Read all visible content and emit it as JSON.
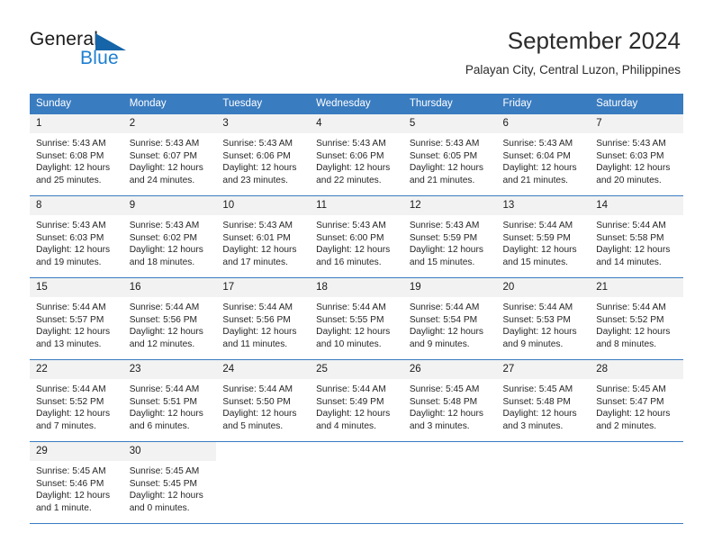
{
  "brand": {
    "name_part1": "General",
    "name_part2": "Blue",
    "logo_icon": "blue-triangle-icon",
    "accent_color": "#1f7fd1",
    "header_color": "#3a7cc0"
  },
  "header": {
    "title": "September 2024",
    "subtitle": "Palayan City, Central Luzon, Philippines"
  },
  "calendar": {
    "weekday_headers": [
      "Sunday",
      "Monday",
      "Tuesday",
      "Wednesday",
      "Thursday",
      "Friday",
      "Saturday"
    ],
    "weeks": [
      [
        {
          "day": "1",
          "sunrise": "Sunrise: 5:43 AM",
          "sunset": "Sunset: 6:08 PM",
          "daylight_line1": "Daylight: 12 hours",
          "daylight_line2": "and 25 minutes."
        },
        {
          "day": "2",
          "sunrise": "Sunrise: 5:43 AM",
          "sunset": "Sunset: 6:07 PM",
          "daylight_line1": "Daylight: 12 hours",
          "daylight_line2": "and 24 minutes."
        },
        {
          "day": "3",
          "sunrise": "Sunrise: 5:43 AM",
          "sunset": "Sunset: 6:06 PM",
          "daylight_line1": "Daylight: 12 hours",
          "daylight_line2": "and 23 minutes."
        },
        {
          "day": "4",
          "sunrise": "Sunrise: 5:43 AM",
          "sunset": "Sunset: 6:06 PM",
          "daylight_line1": "Daylight: 12 hours",
          "daylight_line2": "and 22 minutes."
        },
        {
          "day": "5",
          "sunrise": "Sunrise: 5:43 AM",
          "sunset": "Sunset: 6:05 PM",
          "daylight_line1": "Daylight: 12 hours",
          "daylight_line2": "and 21 minutes."
        },
        {
          "day": "6",
          "sunrise": "Sunrise: 5:43 AM",
          "sunset": "Sunset: 6:04 PM",
          "daylight_line1": "Daylight: 12 hours",
          "daylight_line2": "and 21 minutes."
        },
        {
          "day": "7",
          "sunrise": "Sunrise: 5:43 AM",
          "sunset": "Sunset: 6:03 PM",
          "daylight_line1": "Daylight: 12 hours",
          "daylight_line2": "and 20 minutes."
        }
      ],
      [
        {
          "day": "8",
          "sunrise": "Sunrise: 5:43 AM",
          "sunset": "Sunset: 6:03 PM",
          "daylight_line1": "Daylight: 12 hours",
          "daylight_line2": "and 19 minutes."
        },
        {
          "day": "9",
          "sunrise": "Sunrise: 5:43 AM",
          "sunset": "Sunset: 6:02 PM",
          "daylight_line1": "Daylight: 12 hours",
          "daylight_line2": "and 18 minutes."
        },
        {
          "day": "10",
          "sunrise": "Sunrise: 5:43 AM",
          "sunset": "Sunset: 6:01 PM",
          "daylight_line1": "Daylight: 12 hours",
          "daylight_line2": "and 17 minutes."
        },
        {
          "day": "11",
          "sunrise": "Sunrise: 5:43 AM",
          "sunset": "Sunset: 6:00 PM",
          "daylight_line1": "Daylight: 12 hours",
          "daylight_line2": "and 16 minutes."
        },
        {
          "day": "12",
          "sunrise": "Sunrise: 5:43 AM",
          "sunset": "Sunset: 5:59 PM",
          "daylight_line1": "Daylight: 12 hours",
          "daylight_line2": "and 15 minutes."
        },
        {
          "day": "13",
          "sunrise": "Sunrise: 5:44 AM",
          "sunset": "Sunset: 5:59 PM",
          "daylight_line1": "Daylight: 12 hours",
          "daylight_line2": "and 15 minutes."
        },
        {
          "day": "14",
          "sunrise": "Sunrise: 5:44 AM",
          "sunset": "Sunset: 5:58 PM",
          "daylight_line1": "Daylight: 12 hours",
          "daylight_line2": "and 14 minutes."
        }
      ],
      [
        {
          "day": "15",
          "sunrise": "Sunrise: 5:44 AM",
          "sunset": "Sunset: 5:57 PM",
          "daylight_line1": "Daylight: 12 hours",
          "daylight_line2": "and 13 minutes."
        },
        {
          "day": "16",
          "sunrise": "Sunrise: 5:44 AM",
          "sunset": "Sunset: 5:56 PM",
          "daylight_line1": "Daylight: 12 hours",
          "daylight_line2": "and 12 minutes."
        },
        {
          "day": "17",
          "sunrise": "Sunrise: 5:44 AM",
          "sunset": "Sunset: 5:56 PM",
          "daylight_line1": "Daylight: 12 hours",
          "daylight_line2": "and 11 minutes."
        },
        {
          "day": "18",
          "sunrise": "Sunrise: 5:44 AM",
          "sunset": "Sunset: 5:55 PM",
          "daylight_line1": "Daylight: 12 hours",
          "daylight_line2": "and 10 minutes."
        },
        {
          "day": "19",
          "sunrise": "Sunrise: 5:44 AM",
          "sunset": "Sunset: 5:54 PM",
          "daylight_line1": "Daylight: 12 hours",
          "daylight_line2": "and 9 minutes."
        },
        {
          "day": "20",
          "sunrise": "Sunrise: 5:44 AM",
          "sunset": "Sunset: 5:53 PM",
          "daylight_line1": "Daylight: 12 hours",
          "daylight_line2": "and 9 minutes."
        },
        {
          "day": "21",
          "sunrise": "Sunrise: 5:44 AM",
          "sunset": "Sunset: 5:52 PM",
          "daylight_line1": "Daylight: 12 hours",
          "daylight_line2": "and 8 minutes."
        }
      ],
      [
        {
          "day": "22",
          "sunrise": "Sunrise: 5:44 AM",
          "sunset": "Sunset: 5:52 PM",
          "daylight_line1": "Daylight: 12 hours",
          "daylight_line2": "and 7 minutes."
        },
        {
          "day": "23",
          "sunrise": "Sunrise: 5:44 AM",
          "sunset": "Sunset: 5:51 PM",
          "daylight_line1": "Daylight: 12 hours",
          "daylight_line2": "and 6 minutes."
        },
        {
          "day": "24",
          "sunrise": "Sunrise: 5:44 AM",
          "sunset": "Sunset: 5:50 PM",
          "daylight_line1": "Daylight: 12 hours",
          "daylight_line2": "and 5 minutes."
        },
        {
          "day": "25",
          "sunrise": "Sunrise: 5:44 AM",
          "sunset": "Sunset: 5:49 PM",
          "daylight_line1": "Daylight: 12 hours",
          "daylight_line2": "and 4 minutes."
        },
        {
          "day": "26",
          "sunrise": "Sunrise: 5:45 AM",
          "sunset": "Sunset: 5:48 PM",
          "daylight_line1": "Daylight: 12 hours",
          "daylight_line2": "and 3 minutes."
        },
        {
          "day": "27",
          "sunrise": "Sunrise: 5:45 AM",
          "sunset": "Sunset: 5:48 PM",
          "daylight_line1": "Daylight: 12 hours",
          "daylight_line2": "and 3 minutes."
        },
        {
          "day": "28",
          "sunrise": "Sunrise: 5:45 AM",
          "sunset": "Sunset: 5:47 PM",
          "daylight_line1": "Daylight: 12 hours",
          "daylight_line2": "and 2 minutes."
        }
      ],
      [
        {
          "day": "29",
          "sunrise": "Sunrise: 5:45 AM",
          "sunset": "Sunset: 5:46 PM",
          "daylight_line1": "Daylight: 12 hours",
          "daylight_line2": "and 1 minute."
        },
        {
          "day": "30",
          "sunrise": "Sunrise: 5:45 AM",
          "sunset": "Sunset: 5:45 PM",
          "daylight_line1": "Daylight: 12 hours",
          "daylight_line2": "and 0 minutes."
        },
        {
          "day": "",
          "sunrise": "",
          "sunset": "",
          "daylight_line1": "",
          "daylight_line2": ""
        },
        {
          "day": "",
          "sunrise": "",
          "sunset": "",
          "daylight_line1": "",
          "daylight_line2": ""
        },
        {
          "day": "",
          "sunrise": "",
          "sunset": "",
          "daylight_line1": "",
          "daylight_line2": ""
        },
        {
          "day": "",
          "sunrise": "",
          "sunset": "",
          "daylight_line1": "",
          "daylight_line2": ""
        },
        {
          "day": "",
          "sunrise": "",
          "sunset": "",
          "daylight_line1": "",
          "daylight_line2": ""
        }
      ]
    ]
  }
}
